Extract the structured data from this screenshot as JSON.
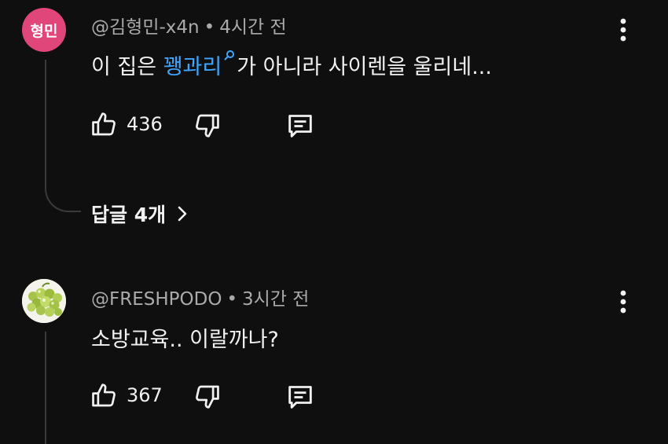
{
  "comments": [
    {
      "avatar_text": "형민",
      "author": "@김형민-x4n",
      "separator": "•",
      "time": "4시간 전",
      "text_before": "이 집은 ",
      "link_text": "꽹과리",
      "text_after": "가 아니라 사이렌을 울리네...",
      "likes": "436",
      "replies_label": "답글 4개"
    },
    {
      "avatar_icon": "grapes-avatar",
      "author": "@FRESHPODO",
      "separator": "•",
      "time": "3시간 전",
      "text": "소방교육.. 이랄까나?",
      "likes": "367"
    }
  ],
  "icons": [
    "more-vert-icon",
    "thumb-up-icon",
    "thumb-down-icon",
    "reply-comment-icon",
    "search-icon",
    "chevron-right-icon"
  ],
  "colors": {
    "background": "#0f0f0f",
    "text": "#f1f1f1",
    "secondary_text": "#aaaaaa",
    "link": "#3ea6ff",
    "avatar_pink": "#e0467a"
  }
}
